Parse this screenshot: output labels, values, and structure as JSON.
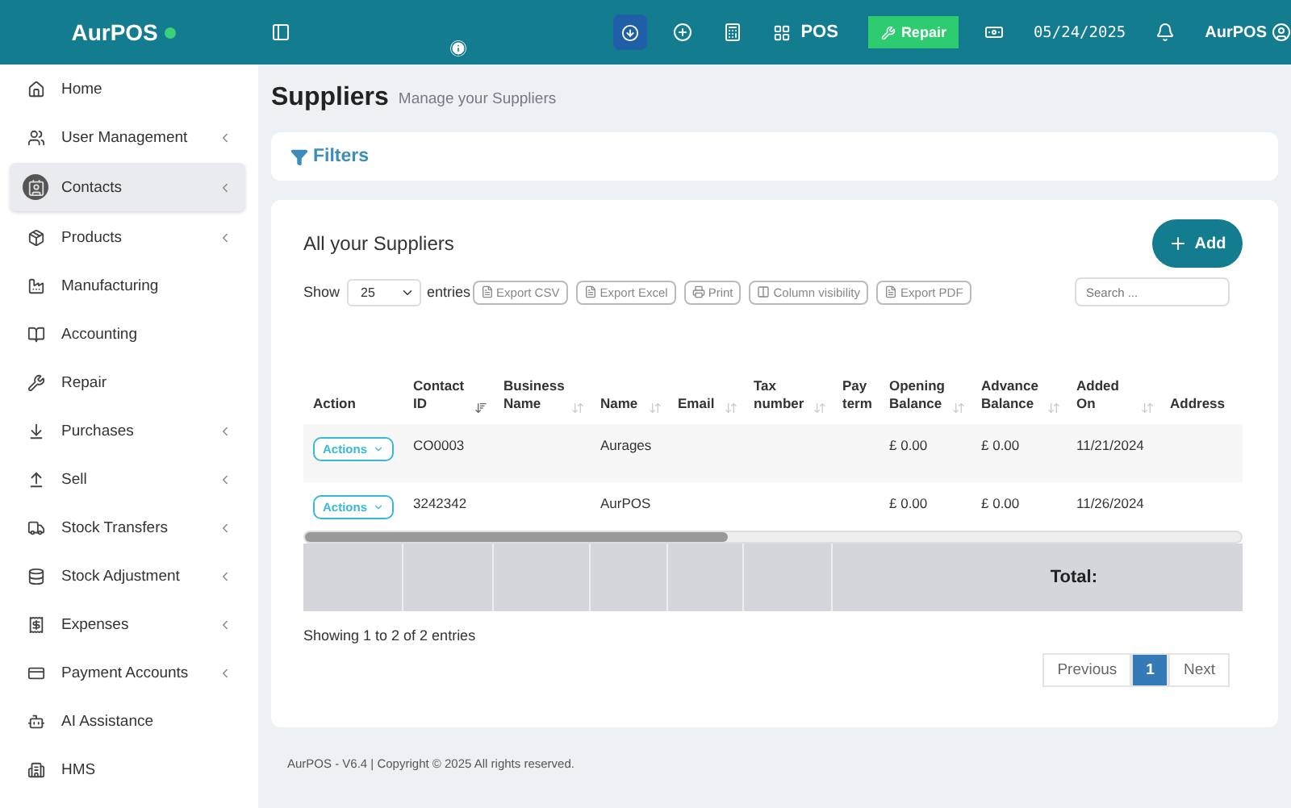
{
  "brand": {
    "name": "AurPOS"
  },
  "topbar": {
    "pos_label": "POS",
    "repair_label": "Repair",
    "date": "05/24/2025",
    "user": "AurPOS"
  },
  "sidebar": {
    "items": [
      {
        "label": "Home",
        "has_submenu": false,
        "selected": false
      },
      {
        "label": "User Management",
        "has_submenu": true,
        "selected": false
      },
      {
        "label": "Contacts",
        "has_submenu": true,
        "selected": true
      },
      {
        "label": "Products",
        "has_submenu": true,
        "selected": false
      },
      {
        "label": "Manufacturing",
        "has_submenu": false,
        "selected": false
      },
      {
        "label": "Accounting",
        "has_submenu": false,
        "selected": false
      },
      {
        "label": "Repair",
        "has_submenu": false,
        "selected": false
      },
      {
        "label": "Purchases",
        "has_submenu": true,
        "selected": false
      },
      {
        "label": "Sell",
        "has_submenu": true,
        "selected": false
      },
      {
        "label": "Stock Transfers",
        "has_submenu": true,
        "selected": false
      },
      {
        "label": "Stock Adjustment",
        "has_submenu": true,
        "selected": false
      },
      {
        "label": "Expenses",
        "has_submenu": true,
        "selected": false
      },
      {
        "label": "Payment Accounts",
        "has_submenu": true,
        "selected": false
      },
      {
        "label": "AI Assistance",
        "has_submenu": false,
        "selected": false
      },
      {
        "label": "HMS",
        "has_submenu": false,
        "selected": false
      }
    ]
  },
  "page": {
    "title": "Suppliers",
    "subtitle": "Manage your Suppliers"
  },
  "filters": {
    "label": "Filters"
  },
  "card": {
    "title": "All your Suppliers",
    "add_label": "Add"
  },
  "controls": {
    "show_label": "Show",
    "page_size": "25",
    "entries_label": "entries",
    "search_placeholder": "Search ...",
    "exports": [
      "Export CSV",
      "Export Excel",
      "Print",
      "Column visibility",
      "Export PDF"
    ]
  },
  "table": {
    "columns": [
      {
        "label": "Action",
        "kind": "plain"
      },
      {
        "label": "Contact ID",
        "kind": "sorted"
      },
      {
        "label": "Business Name",
        "kind": "sortable"
      },
      {
        "label": "Name",
        "kind": "sortable"
      },
      {
        "label": "Email",
        "kind": "sortable"
      },
      {
        "label": "Tax number",
        "kind": "sortable"
      },
      {
        "label": "Pay term",
        "kind": "plain"
      },
      {
        "label": "Opening Balance",
        "kind": "sortable"
      },
      {
        "label": "Advance Balance",
        "kind": "sortable"
      },
      {
        "label": "Added On",
        "kind": "sortable"
      },
      {
        "label": "Address",
        "kind": "plain"
      }
    ],
    "rows": [
      {
        "cells": [
          "Actions",
          "CO0003",
          "",
          "Aurages",
          "",
          "",
          "",
          "£ 0.00",
          "£ 0.00",
          "11/21/2024",
          ""
        ]
      },
      {
        "cells": [
          "Actions",
          "3242342",
          "",
          "AurPOS",
          "",
          "",
          "",
          "£ 0.00",
          "£ 0.00",
          "11/26/2024",
          ""
        ]
      }
    ],
    "total_label": "Total:"
  },
  "info": "Showing 1 to 2 of 2 entries",
  "pagination": {
    "previous": "Previous",
    "next": "Next",
    "pages": [
      {
        "label": "1",
        "selected": true
      }
    ]
  },
  "footer": {
    "text": "AurPOS - V6.4 | Copyright © 2025 All rights reserved."
  }
}
